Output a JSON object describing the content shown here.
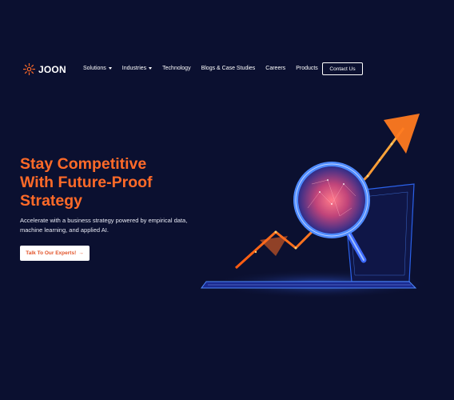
{
  "brand": {
    "name": "JOON",
    "icon": "joon-logo-icon"
  },
  "nav": {
    "items": [
      {
        "label": "Solutions",
        "has_dropdown": true
      },
      {
        "label": "Industries",
        "has_dropdown": true
      },
      {
        "label": "Technology",
        "has_dropdown": false
      },
      {
        "label": "Blogs & Case Studies",
        "has_dropdown": false
      },
      {
        "label": "Careers",
        "has_dropdown": false
      },
      {
        "label": "Products",
        "has_dropdown": false
      }
    ],
    "contact_label": "Contact Us"
  },
  "hero": {
    "title_lines": [
      "Stay Competitive",
      "With Future-Proof",
      "Strategy"
    ],
    "subtitle_lines": [
      "Accelerate with a business strategy powered by empirical data,",
      "machine learning, and applied AI."
    ],
    "cta_label": "Talk To Our Experts!",
    "cta_icon": "arrow-right-icon",
    "illustration_icon": "laptop-magnifier-growth-icon"
  },
  "colors": {
    "background": "#0b1030",
    "accent": "#ff6a28",
    "cta_text": "#e2542a",
    "text": "#ffffff",
    "glow_blue": "#2f6bff"
  }
}
